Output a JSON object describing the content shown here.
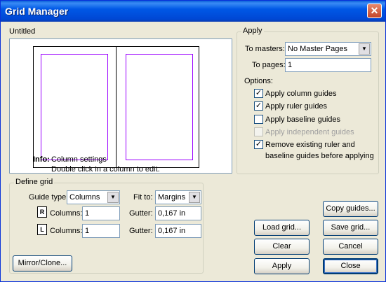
{
  "window": {
    "title": "Grid Manager",
    "close_glyph": "✕"
  },
  "preview": {
    "doc_name": "Untitled",
    "info_label": "Info:",
    "info_line1": "Column settings",
    "info_line2": "Double click in a column to edit.",
    "margin_color": "#9a00ff"
  },
  "apply_group": {
    "label": "Apply",
    "to_masters_label": "To masters:",
    "to_masters_value": "No Master Pages",
    "to_pages_label": "To pages:",
    "to_pages_value": "1",
    "options_label": "Options:",
    "options": [
      {
        "label": "Apply column guides",
        "checked": true,
        "enabled": true
      },
      {
        "label": "Apply ruler guides",
        "checked": true,
        "enabled": true
      },
      {
        "label": "Apply baseline guides",
        "checked": false,
        "enabled": true
      },
      {
        "label": "Apply independent guides",
        "checked": false,
        "enabled": false
      },
      {
        "label": "Remove existing ruler and",
        "label2": "baseline guides before applying",
        "checked": true,
        "enabled": true
      }
    ]
  },
  "define_group": {
    "label": "Define grid",
    "guide_type_label": "Guide type:",
    "guide_type_value": "Columns",
    "fit_to_label": "Fit to:",
    "fit_to_value": "Margins",
    "right_icon": "R",
    "left_icon": "L",
    "columns_label": "Columns:",
    "right_columns": "1",
    "left_columns": "1",
    "gutter_label": "Gutter:",
    "right_gutter": "0,167 in",
    "left_gutter": "0,167 in"
  },
  "buttons": {
    "mirror_clone": "Mirror/Clone...",
    "copy_guides": "Copy guides...",
    "load_grid": "Load grid...",
    "save_grid": "Save grid...",
    "clear": "Clear",
    "cancel": "Cancel",
    "apply": "Apply",
    "close": "Close"
  }
}
